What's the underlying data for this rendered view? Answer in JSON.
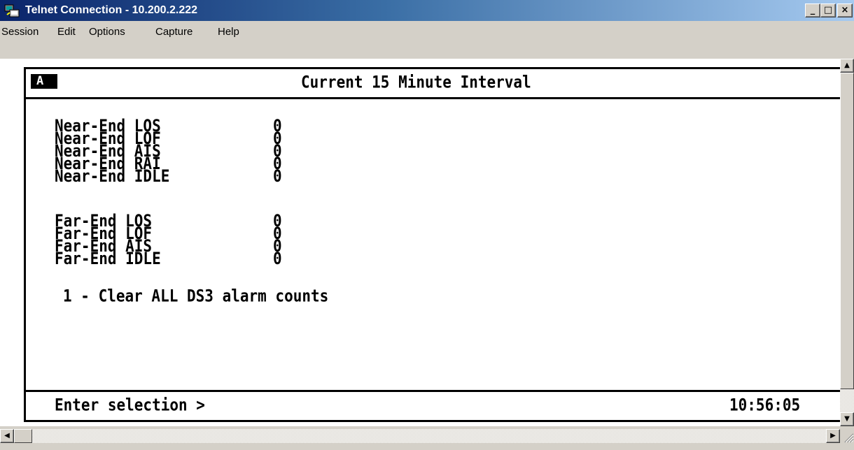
{
  "window": {
    "title": "Telnet Connection - 10.200.2.222",
    "controls": {
      "minimize": "_",
      "maximize": "□",
      "close": "×"
    }
  },
  "menu": {
    "items": [
      "Session",
      "Edit",
      "Options",
      "Capture",
      "Help"
    ]
  },
  "terminal": {
    "badge": "A",
    "header": "Current 15 Minute Interval",
    "near_end": [
      {
        "label": "Near-End LOS",
        "value": "0"
      },
      {
        "label": "Near-End LOF",
        "value": "0"
      },
      {
        "label": "Near-End AIS",
        "value": "0"
      },
      {
        "label": "Near-End RAI",
        "value": "0"
      },
      {
        "label": "Near-End IDLE",
        "value": "0"
      }
    ],
    "far_end": [
      {
        "label": "Far-End LOS",
        "value": "0"
      },
      {
        "label": "Far-End LOF",
        "value": "0"
      },
      {
        "label": "Far-End AIS",
        "value": "0"
      },
      {
        "label": "Far-End IDLE",
        "value": "0"
      }
    ],
    "menu_option": "1 - Clear ALL DS3 alarm counts",
    "prompt": "Enter selection >",
    "clock": "10:56:05"
  },
  "icons": {
    "app": "telnet-app-icon",
    "scroll_up": "▲",
    "scroll_down": "▼",
    "scroll_left": "◀",
    "scroll_right": "▶"
  }
}
